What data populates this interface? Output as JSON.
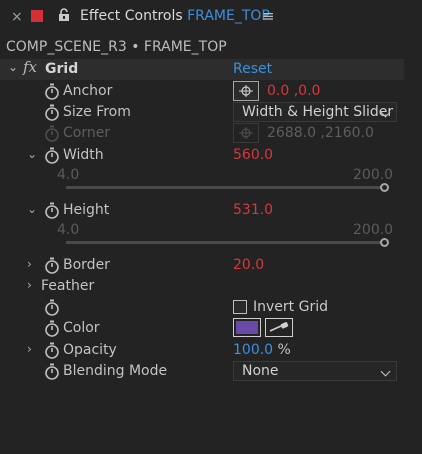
{
  "tab": {
    "close_glyph": "×",
    "label_color": "#d4303a",
    "panel_name": "Effect Controls",
    "layer_name": "FRAME_TOP",
    "menu_glyph": "≡"
  },
  "breadcrumb": {
    "text": "COMP_SCENE_R3 • FRAME_TOP"
  },
  "effect": {
    "fx_label": "fx",
    "name": "Grid",
    "reset_label": "Reset",
    "twirl": "⌄"
  },
  "props": {
    "anchor": {
      "label": "Anchor",
      "value": "0.0 ,0.0"
    },
    "size_from": {
      "label": "Size From",
      "value": "Width & Height Slider"
    },
    "corner": {
      "label": "Corner",
      "value": "2688.0 ,2160.0"
    },
    "width": {
      "label": "Width",
      "value": "560.0",
      "min": "4.0",
      "max": "200.0",
      "twirl": "⌄"
    },
    "height": {
      "label": "Height",
      "value": "531.0",
      "min": "4.0",
      "max": "200.0",
      "twirl": "⌄"
    },
    "border": {
      "label": "Border",
      "value": "20.0",
      "twirl": "›"
    },
    "feather": {
      "label": "Feather",
      "twirl": "›"
    },
    "invert_grid": {
      "label": "Invert Grid",
      "checked": false
    },
    "color": {
      "label": "Color",
      "swatch": "#6a4aa8"
    },
    "opacity": {
      "label": "Opacity",
      "value": "100.0",
      "unit": "%",
      "twirl": "›"
    },
    "blending_mode": {
      "label": "Blending Mode",
      "value": "None"
    }
  },
  "colors": {
    "accent_blue": "#3d8fe0",
    "value_red": "#d9363e",
    "background": "#232323"
  }
}
